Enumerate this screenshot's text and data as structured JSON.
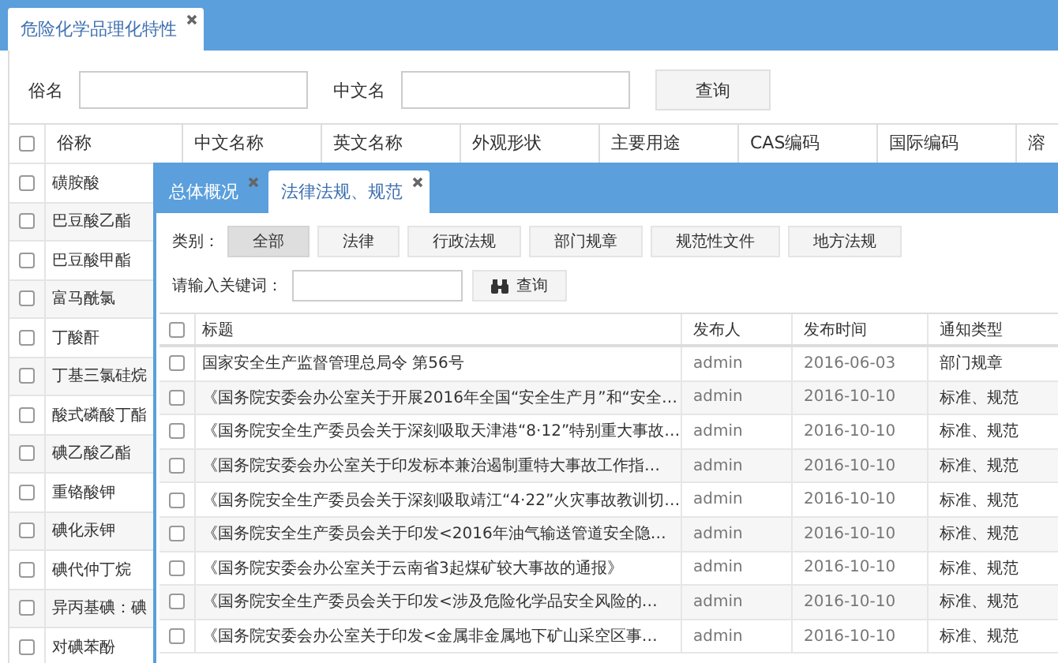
{
  "main_tab": {
    "label": "危险化学品理化特性",
    "selected": true
  },
  "search": {
    "fields": [
      {
        "label": "俗名"
      },
      {
        "label": "中文名"
      }
    ],
    "button": "查询"
  },
  "table": {
    "select_all_checked": false,
    "columns": [
      "俗称",
      "中文名称",
      "英文名称",
      "外观形状",
      "主要用途",
      "CAS编码",
      "国际编码",
      "溶"
    ],
    "rows": [
      {
        "name": "磺胺酸",
        "checked": false
      },
      {
        "name": "巴豆酸乙酯",
        "checked": false
      },
      {
        "name": "巴豆酸甲酯",
        "checked": false
      },
      {
        "name": "富马酰氯",
        "checked": false
      },
      {
        "name": "丁酸酐",
        "checked": false
      },
      {
        "name": "丁基三氯硅烷",
        "checked": false
      },
      {
        "name": "酸式磷酸丁酯",
        "checked": false
      },
      {
        "name": "碘乙酸乙酯",
        "checked": false
      },
      {
        "name": "重铬酸钾",
        "checked": false
      },
      {
        "name": "碘化汞钾",
        "checked": false
      },
      {
        "name": "碘代仲丁烷",
        "checked": false
      },
      {
        "name": "异丙基碘：碘",
        "checked": false
      },
      {
        "name": "对碘苯酚",
        "checked": false
      }
    ]
  },
  "dialog": {
    "select_all_checked": false,
    "tabs": [
      {
        "label": "总体概况",
        "selected": false
      },
      {
        "label": "法律法规、规范",
        "selected": true
      }
    ],
    "category_label": "类别：",
    "categories": [
      {
        "label": "全部",
        "selected": true
      },
      {
        "label": "法律",
        "selected": false
      },
      {
        "label": "行政法规",
        "selected": false
      },
      {
        "label": "部门规章",
        "selected": false
      },
      {
        "label": "规范性文件",
        "selected": false
      },
      {
        "label": "地方法规",
        "selected": false
      }
    ],
    "keyword_label": "请输入关键词：",
    "search_button": "查询",
    "columns": [
      "标题",
      "发布人",
      "发布时间",
      "通知类型"
    ],
    "rows": [
      {
        "title": "国家安全生产监督管理总局令 第56号",
        "publisher": "admin",
        "date": "2016-06-03",
        "type": "部门规章",
        "checked": false
      },
      {
        "title": "《国务院安委会办公室关于开展2016年全国“安全生产月”和“安全…",
        "publisher": "admin",
        "date": "2016-10-10",
        "type": "标准、规范",
        "checked": false
      },
      {
        "title": "《国务院安全生产委员会关于深刻吸取天津港“8·12”特别重大事故…",
        "publisher": "admin",
        "date": "2016-10-10",
        "type": "标准、规范",
        "checked": false
      },
      {
        "title": "《国务院安委会办公室关于印发标本兼治遏制重特大事故工作指…",
        "publisher": "admin",
        "date": "2016-10-10",
        "type": "标准、规范",
        "checked": false
      },
      {
        "title": "《国务院安全生产委员会关于深刻吸取靖江“4·22”火灾事故教训切…",
        "publisher": "admin",
        "date": "2016-10-10",
        "type": "标准、规范",
        "checked": false
      },
      {
        "title": "《国务院安全生产委员会关于印发<2016年油气输送管道安全隐…",
        "publisher": "admin",
        "date": "2016-10-10",
        "type": "标准、规范",
        "checked": false
      },
      {
        "title": "《国务院安委会办公室关于云南省3起煤矿较大事故的通报》",
        "publisher": "admin",
        "date": "2016-10-10",
        "type": "标准、规范",
        "checked": false
      },
      {
        "title": "《国务院安全生产委员会关于印发<涉及危险化学品安全风险的…",
        "publisher": "admin",
        "date": "2016-10-10",
        "type": "标准、规范",
        "checked": false
      },
      {
        "title": "《国务院安委会办公室关于印发<金属非金属地下矿山采空区事…",
        "publisher": "admin",
        "date": "2016-10-10",
        "type": "标准、规范",
        "checked": false
      }
    ]
  }
}
